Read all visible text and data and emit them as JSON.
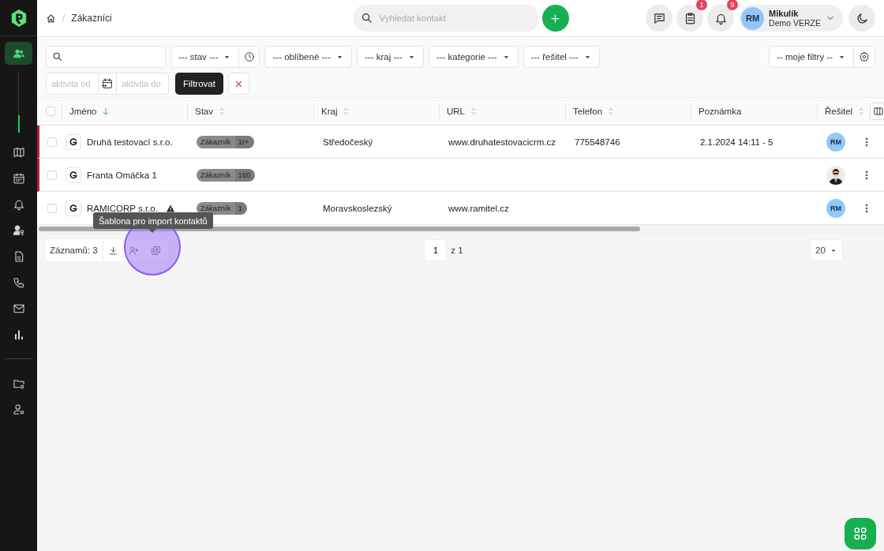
{
  "sidebar": {
    "items": [
      {
        "kind": "contacts",
        "selected": true
      },
      {
        "kind": "map",
        "selected": false
      },
      {
        "kind": "calendar",
        "selected": false
      },
      {
        "kind": "bell",
        "selected": false
      },
      {
        "kind": "user-key",
        "selected": false
      },
      {
        "kind": "document",
        "selected": false
      },
      {
        "kind": "phone",
        "selected": false
      },
      {
        "kind": "mail",
        "selected": false
      },
      {
        "kind": "chart",
        "selected": false
      },
      {
        "kind": "divider"
      },
      {
        "kind": "folder-gear",
        "selected": false
      },
      {
        "kind": "user-gear",
        "selected": false
      }
    ]
  },
  "topbar": {
    "breadcrumb": {
      "separator": "/",
      "current": "Zákazníci"
    },
    "search": {
      "placeholder": "Vyhledat kontakt"
    },
    "buttons": [
      {
        "kind": "chat"
      },
      {
        "kind": "clipboard",
        "badge": "1"
      },
      {
        "kind": "bell",
        "badge": "9"
      }
    ],
    "user": {
      "initials": "RM",
      "name": "Mikulík",
      "subtitle": "Demo VERZE"
    }
  },
  "filters": {
    "dropdowns": [
      {
        "label": "--- stav ---",
        "kind": "with-clock"
      },
      {
        "label": "--- oblíbené ---",
        "kind": "plain"
      },
      {
        "label": "--- kraj ---",
        "kind": "plain"
      },
      {
        "label": "--- kategorie ---",
        "kind": "plain"
      },
      {
        "label": "--- řešitel ---",
        "kind": "plain"
      }
    ],
    "date_from": {
      "placeholder": "aktivita od"
    },
    "date_to": {
      "placeholder": "aktivita do"
    },
    "apply_button": "Filtrovat",
    "my_filters": "-- moje filtry --"
  },
  "table": {
    "header_checked": false,
    "columns": [
      {
        "label": "Jméno",
        "sortable": true,
        "sorted": true
      },
      {
        "label": "Stav",
        "sortable": true,
        "sorted": false
      },
      {
        "label": "Kraj",
        "sortable": true,
        "sorted": false
      },
      {
        "label": "URL",
        "sortable": true,
        "sorted": false
      },
      {
        "label": "Telefon",
        "sortable": true,
        "sorted": false
      },
      {
        "label": "Poznámka",
        "sortable": false
      },
      {
        "label": "Řešitel",
        "sortable": true,
        "sorted": false
      }
    ],
    "rows": [
      {
        "checked": false,
        "marked": true,
        "name": "Druhá testovací s.r.o.",
        "warning": false,
        "status": "Zákazník",
        "status_count": "1r+",
        "region": "Středočeský",
        "url": "www.druhatestovacicrm.cz",
        "phone": "775548746",
        "note": "2.1.2024 14:11 - 5",
        "assignee": {
          "kind": "initials",
          "text": "RM"
        }
      },
      {
        "checked": false,
        "marked": true,
        "name": "Franta Omáčka 1",
        "warning": false,
        "status": "Zákazník",
        "status_count": "150"
      },
      {
        "checked": false,
        "marked": false,
        "name": "RAMICORP s.r.o.",
        "warning": true,
        "status": "Zákazník",
        "status_count": "1",
        "region": "Moravskoslezský",
        "url": "www.ramitel.cz",
        "assignee": {
          "kind": "initials",
          "text": "RM"
        }
      }
    ]
  },
  "footer": {
    "records": "Záznamů: 3",
    "page": "1",
    "page_total": "z 1",
    "page_size": "20",
    "tooltip": "Šablona pro import kontaktů"
  }
}
